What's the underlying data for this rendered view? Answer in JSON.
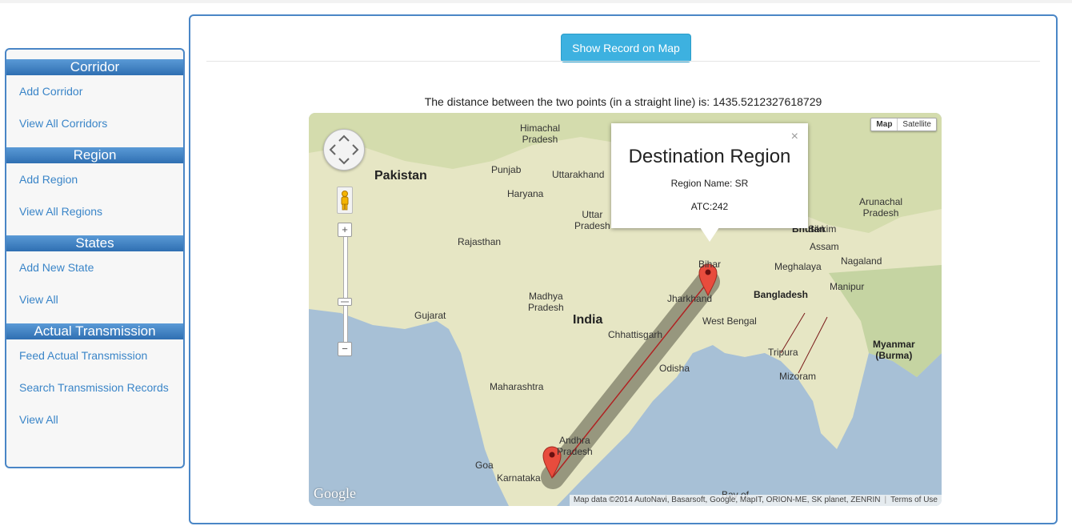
{
  "sidebar": {
    "sections": [
      {
        "title": "Corridor",
        "links": [
          "Add Corridor",
          "View All Corridors"
        ]
      },
      {
        "title": "Region",
        "links": [
          "Add Region",
          "View All Regions"
        ]
      },
      {
        "title": "States",
        "links": [
          "Add New State",
          "View All"
        ]
      },
      {
        "title": "Actual Transmission",
        "links": [
          "Feed Actual Transmission",
          "Search Transmission Records",
          "View All"
        ]
      }
    ]
  },
  "main": {
    "show_button": "Show Record on Map",
    "distance_text": "The distance between the two points (in a straight line) is: 1435.5212327618729"
  },
  "map": {
    "map_type": {
      "map": "Map",
      "satellite": "Satellite"
    },
    "zoom_in": "+",
    "zoom_out": "−",
    "logo": "Google",
    "attribution": "Map data ©2014 AutoNavi, Basarsoft, Google, MapIT, ORION-ME, SK planet, ZENRIN",
    "terms": "Terms of Use",
    "info_window": {
      "title": "Destination Region",
      "region_name": "Region Name: SR",
      "atc": "ATC:242",
      "close": "×"
    },
    "labels": {
      "pakistan": "Pakistan",
      "punjab": "Punjab",
      "himachal": "Himachal\nPradesh",
      "uttarakhand": "Uttarakhand",
      "haryana": "Haryana",
      "uttar": "Uttar\nPradesh",
      "rajasthan": "Rajasthan",
      "madhya": "Madhya\nPradesh",
      "gujarat": "Gujarat",
      "india": "India",
      "chhattisgarh": "Chhattisgarh",
      "jharkhand": "Jharkhand",
      "bihar": "Bihar",
      "west_bengal": "West Bengal",
      "odisha": "Odisha",
      "maharashtra": "Maharashtra",
      "andhra": "Andhra\nPradesh",
      "goa": "Goa",
      "karnataka": "Karnataka",
      "bangladesh": "Bangladesh",
      "tripura": "Tripura",
      "mizoram": "Mizoram",
      "meghalaya": "Meghalaya",
      "assam": "Assam",
      "nagaland": "Nagaland",
      "manipur": "Manipur",
      "arunachal": "Arunachal\nPradesh",
      "sikkim": "Sikkim",
      "bhutan": "Bhutan",
      "myanmar": "Myanmar\n(Burma)",
      "bay": "Bay of"
    }
  },
  "colors": {
    "accent": "#4a86c6",
    "button": "#3db1e0",
    "link": "#3a85c8",
    "marker": "#e84c3d",
    "route": "#8b1a1a",
    "land": "#e6e6c4",
    "sea": "#a7c0d6"
  }
}
